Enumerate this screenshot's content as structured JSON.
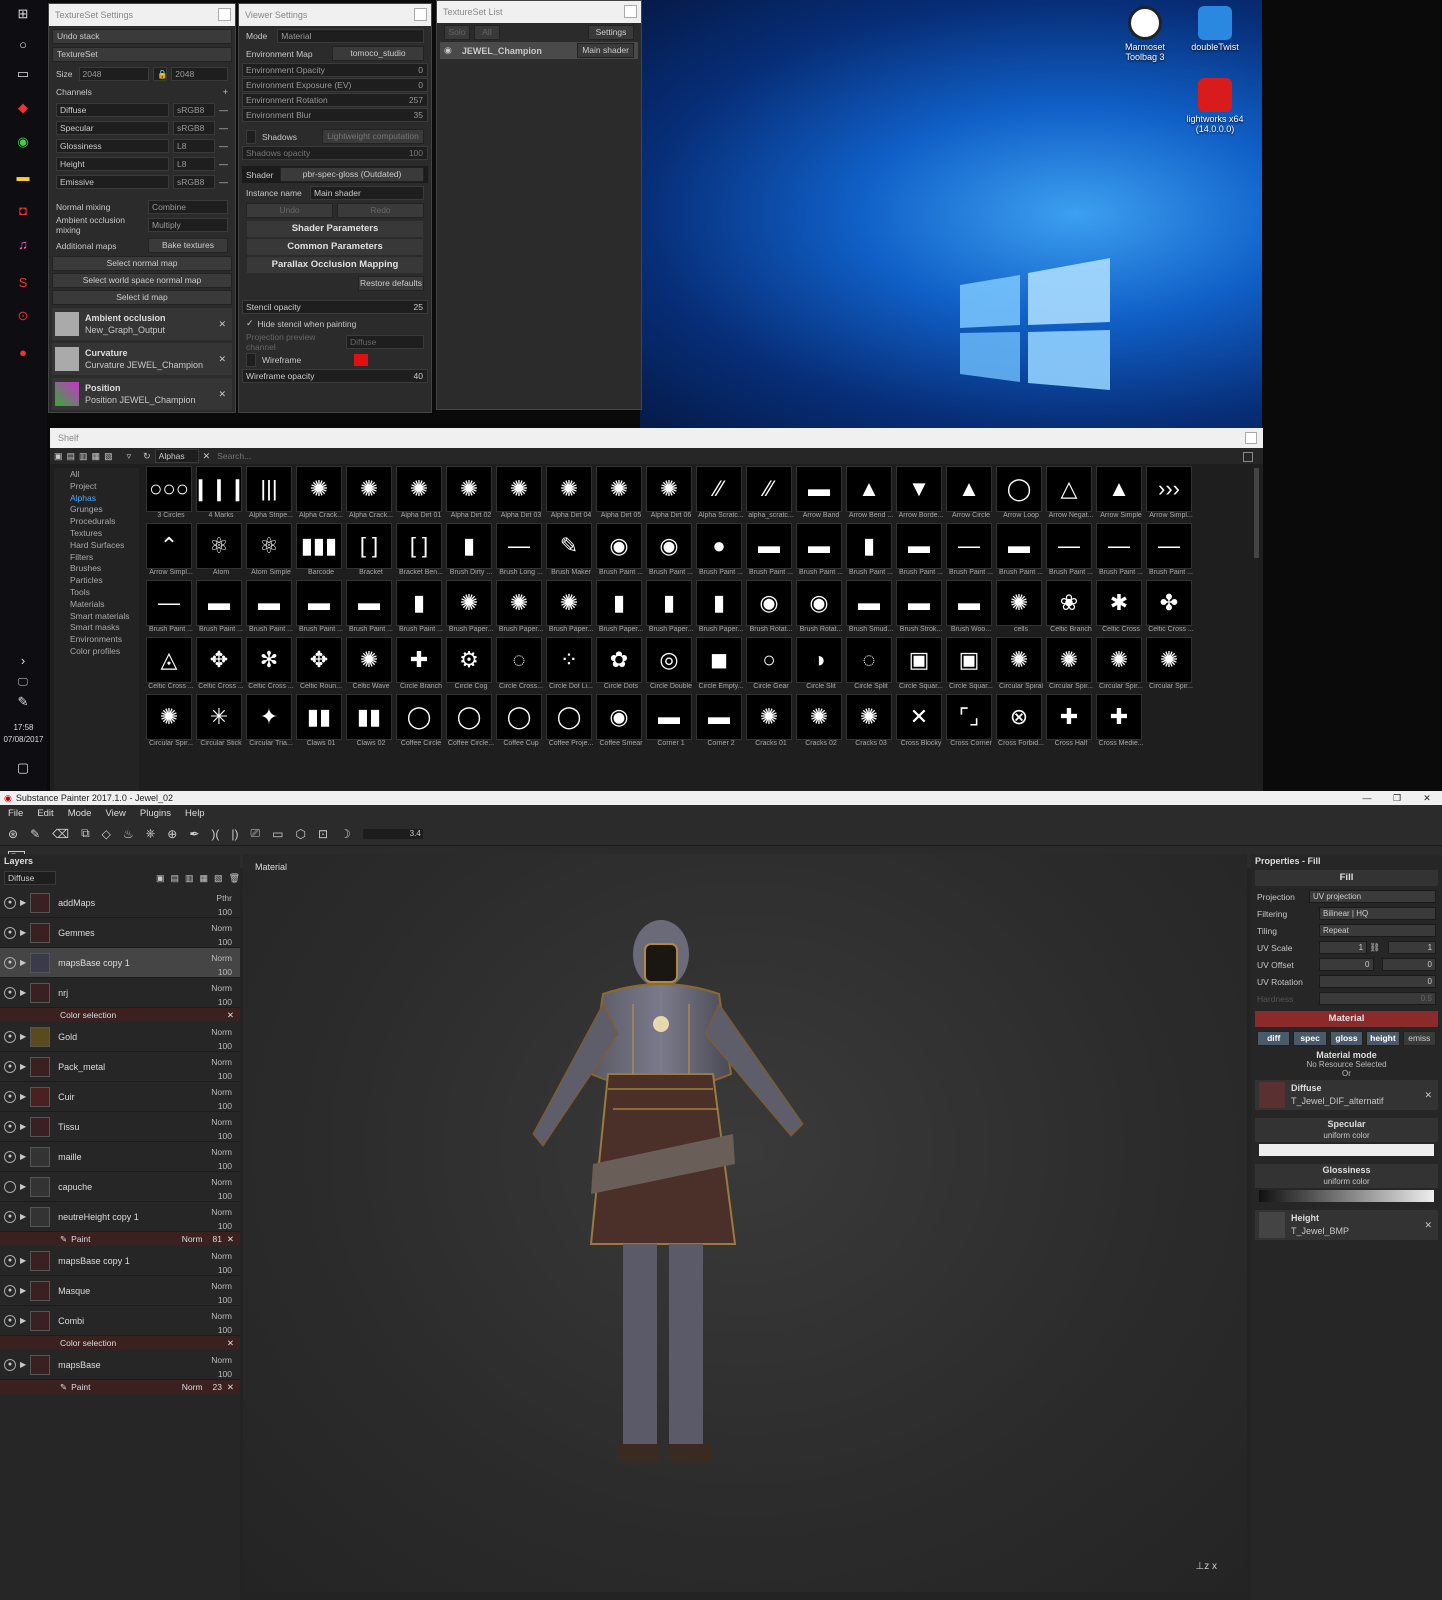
{
  "taskbar": {
    "time": "17:58",
    "date": "07/08/2017"
  },
  "desktop": {
    "icons": [
      {
        "label": "Marmoset Toolbag 3"
      },
      {
        "label": "doubleTwist"
      },
      {
        "label": "lightworks x64 (14.0.0.0)"
      }
    ]
  },
  "texset_settings": {
    "title": "TextureSet Settings",
    "undo": "Undo stack",
    "textureset": "TextureSet",
    "size_label": "Size",
    "size_value": "2048",
    "size_value2": "2048",
    "channels_label": "Channels",
    "channels": [
      {
        "name": "Diffuse",
        "format": "sRGB8"
      },
      {
        "name": "Specular",
        "format": "sRGB8"
      },
      {
        "name": "Glossiness",
        "format": "L8"
      },
      {
        "name": "Height",
        "format": "L8"
      },
      {
        "name": "Emissive",
        "format": "sRGB8"
      }
    ],
    "normal_mixing": "Normal mixing",
    "normal_mixing_val": "Combine",
    "ao_mixing": "Ambient occlusion mixing",
    "ao_mixing_val": "Multiply",
    "additional_maps": "Additional maps",
    "bake": "Bake textures",
    "sel_normal": "Select normal map",
    "sel_world": "Select world space normal map",
    "sel_id": "Select id map",
    "maps": [
      {
        "title": "Ambient occlusion",
        "sub": "New_Graph_Output"
      },
      {
        "title": "Curvature",
        "sub": "Curvature JEWEL_Champion"
      },
      {
        "title": "Position",
        "sub": "Position JEWEL_Champion"
      }
    ]
  },
  "viewer_settings": {
    "title": "Viewer Settings",
    "mode_label": "Mode",
    "mode_value": "Material",
    "env_map_label": "Environment Map",
    "env_map_value": "tomoco_studio",
    "sliders": [
      {
        "label": "Environment Opacity",
        "value": "0"
      },
      {
        "label": "Environment Exposure (EV)",
        "value": "0"
      },
      {
        "label": "Environment Rotation",
        "value": "257"
      },
      {
        "label": "Environment Blur",
        "value": "35"
      }
    ],
    "shadows": "Shadows",
    "lightweight": "Lightweight computation",
    "shadows_opacity": "Shadows opacity",
    "shadows_opacity_val": "100",
    "shader_label": "Shader",
    "shader_value": "pbr-spec-gloss (Outdated)",
    "instance_label": "Instance name",
    "instance_value": "Main shader",
    "undo": "Undo",
    "redo": "Redo",
    "sections": [
      "Shader Parameters",
      "Common Parameters",
      "Parallax Occlusion Mapping"
    ],
    "restore": "Restore defaults",
    "stencil_opacity": "Stencil opacity",
    "stencil_val": "25",
    "hide_stencil": "Hide stencil when painting",
    "proj_channel": "Projection preview channel",
    "proj_channel_val": "Diffuse",
    "wireframe": "Wireframe",
    "wire_opacity": "Wireframe opacity",
    "wire_val": "40"
  },
  "texset_list": {
    "title": "TextureSet List",
    "solo": "Solo",
    "all": "All",
    "settings": "Settings",
    "item": "JEWEL_Champion",
    "item_shader": "Main shader"
  },
  "shelf": {
    "title": "Shelf",
    "filter": "Alphas",
    "search": "Search...",
    "categories": [
      "All",
      "Project",
      "Alphas",
      "Grunges",
      "Procedurals",
      "Textures",
      "Hard Surfaces",
      "Filters",
      "Brushes",
      "Particles",
      "Tools",
      "Materials",
      "Smart materials",
      "Smart masks",
      "Environments",
      "Color profiles"
    ],
    "items": [
      "3 Circles",
      "4 Marks",
      "Alpha Stripe...",
      "Alpha Crack...",
      "Alpha Crack...",
      "Alpha Dirt 01",
      "Alpha Dirt 02",
      "Alpha Dirt 03",
      "Alpha Dirt 04",
      "Alpha Dirt 05",
      "Alpha Dirt 06",
      "Alpha Scratc...",
      "alpha_scratc...",
      "Arrow Band",
      "Arrow Bend ...",
      "Arrow Borde...",
      "Arrow Circle",
      "Arrow Loop",
      "Arrow Negat...",
      "Arrow Simple",
      "Arrow Simpl...",
      "Arrow Simpl...",
      "Atom",
      "Atom Simple",
      "Barcode",
      "Bracket",
      "Bracket Ben...",
      "Brush Dirty ...",
      "Brush Long ...",
      "Brush Maker",
      "Brush Paint ...",
      "Brush Paint ...",
      "Brush Paint ...",
      "Brush Paint ...",
      "Brush Paint ...",
      "Brush Paint ...",
      "Brush Paint ...",
      "Brush Paint ...",
      "Brush Paint ...",
      "Brush Paint ...",
      "Brush Paint ...",
      "Brush Paint ...",
      "Brush Paint ...",
      "Brush Paint ...",
      "Brush Paint ...",
      "Brush Paint ...",
      "Brush Paint ...",
      "Brush Paint ...",
      "Brush Paper...",
      "Brush Paper...",
      "Brush Paper...",
      "Brush Paper...",
      "Brush Paper...",
      "Brush Paper...",
      "Brush Rotat...",
      "Brush Rotat...",
      "Brush Smud...",
      "Brush Strok...",
      "Brush Woo...",
      "cells",
      "Celtic Branch",
      "Celtic Cross",
      "Celtic Cross ...",
      "Celtic Cross ...",
      "Celtic Cross ...",
      "Celtic Cross ...",
      "Celtic Roun...",
      "Celtic Wave",
      "Circle Branch",
      "Circle Cog",
      "Circle Cross...",
      "Circle Dot Li...",
      "Circle Dots",
      "Circle Double",
      "Circle Empty...",
      "Circle Gear",
      "Circle Slit",
      "Circle Split",
      "Circle Squar...",
      "Circle Squar...",
      "Circular Spiral",
      "Circular Spir...",
      "Circular Spir...",
      "Circular Spir...",
      "Circular Spir...",
      "Circular Stick",
      "Circular Tria...",
      "Claws 01",
      "Claws 02",
      "Coffee Circle",
      "Coffee Circle...",
      "Coffee Cup",
      "Coffee Proje...",
      "Coffee Smear",
      "Corner 1",
      "Corner 2",
      "Cracks 01",
      "Cracks 02",
      "Cracks 03",
      "Cross Blocky",
      "Cross Corner",
      "Cross Forbid...",
      "Cross Half",
      "Cross Medie..."
    ],
    "glyphs": [
      "○○○",
      "❙❙❙",
      "|||",
      "✺",
      "✺",
      "✺",
      "✺",
      "✺",
      "✺",
      "✺",
      "✺",
      "⁄⁄",
      "⁄⁄",
      "▬",
      "▲",
      "▼",
      "▲",
      "◯",
      "△",
      "▲",
      "›››",
      "⌃",
      "⚛",
      "⚛",
      "▮▮▮",
      "[ ]",
      "[ ]",
      "▮",
      "—",
      "✎",
      "◉",
      "◉",
      "●",
      "▬",
      "▬",
      "▮",
      "▬",
      "—",
      "▬",
      "—",
      "—",
      "—",
      "—",
      "▬",
      "▬",
      "▬",
      "▬",
      "▮",
      "✺",
      "✺",
      "✺",
      "▮",
      "▮",
      "▮",
      "◉",
      "◉",
      "▬",
      "▬",
      "▬",
      "✺",
      "❀",
      "✱",
      "✤",
      "◬",
      "✥",
      "✻",
      "✥",
      "✺",
      "✚",
      "⚙",
      "◌",
      "⁘",
      "✿",
      "◎",
      "◼",
      "○",
      "◑",
      "◌",
      "▣",
      "▣",
      "✺",
      "✺",
      "✺",
      "✺",
      "✺",
      "✳",
      "✦",
      "▮▮",
      "▮▮",
      "◯",
      "◯",
      "◯",
      "◯",
      "◉",
      "▬",
      "▬",
      "✺",
      "✺",
      "✺",
      "✕",
      "⌜⌟",
      "⊗",
      "✚",
      "✚"
    ]
  },
  "sp": {
    "title": "Substance Painter 2017.1.0 - Jewel_02",
    "menu": [
      "File",
      "Edit",
      "Mode",
      "View",
      "Plugins",
      "Help"
    ],
    "toolbar_val": "3.4",
    "layers_title": "Layers",
    "channel": "Diffuse",
    "viewport_label": "Material",
    "layers": [
      {
        "name": "addMaps",
        "blend": "Pthr",
        "op": "100"
      },
      {
        "name": "Gemmes",
        "blend": "Norm",
        "op": "100"
      },
      {
        "name": "mapsBase copy 1",
        "blend": "Norm",
        "op": "100"
      },
      {
        "name": "nrj",
        "blend": "Norm",
        "op": "100"
      },
      {
        "name": "Gold",
        "blend": "Norm",
        "op": "100"
      },
      {
        "name": "Pack_metal",
        "blend": "Norm",
        "op": "100"
      },
      {
        "name": "Cuir",
        "blend": "Norm",
        "op": "100"
      },
      {
        "name": "Tissu",
        "blend": "Norm",
        "op": "100"
      },
      {
        "name": "maille",
        "blend": "Norm",
        "op": "100"
      },
      {
        "name": "capuche",
        "blend": "Norm",
        "op": "100"
      },
      {
        "name": "neutreHeight copy 1",
        "blend": "Norm",
        "op": "100"
      },
      {
        "name": "mapsBase copy 1",
        "blend": "Norm",
        "op": "100"
      },
      {
        "name": "Masque",
        "blend": "Norm",
        "op": "100"
      },
      {
        "name": "Combi",
        "blend": "Norm",
        "op": "100"
      },
      {
        "name": "mapsBase",
        "blend": "Norm",
        "op": "100"
      }
    ],
    "effects": {
      "color_sel": "Color selection",
      "paint": "Paint",
      "paint_blend": "Norm",
      "paint_op1": "81",
      "paint_op2": "23"
    },
    "props": {
      "title": "Properties - Fill",
      "fill": "Fill",
      "projection": "Projection",
      "projection_val": "UV projection",
      "filtering": "Filtering",
      "filtering_val": "Bilinear | HQ",
      "tiling": "Tiling",
      "tiling_val": "Repeat",
      "uv_scale": "UV Scale",
      "uv_scale_val": "1",
      "uv_offset": "UV Offset",
      "uv_offset_val": "0",
      "uv_rotation": "UV Rotation",
      "uv_rotation_val": "0",
      "hardness": "Hardness",
      "hardness_val": "0.5",
      "material": "Material",
      "chips": [
        "diff",
        "spec",
        "gloss",
        "height",
        "emiss"
      ],
      "material_mode": "Material mode",
      "no_resource": "No Resource Selected",
      "or": "Or",
      "diffuse": "Diffuse",
      "diffuse_map": "T_Jewel_DIF_alternatif",
      "specular": "Specular",
      "uniform": "uniform color",
      "glossiness": "Glossiness",
      "height": "Height",
      "height_map": "T_Jewel_BMP"
    }
  }
}
